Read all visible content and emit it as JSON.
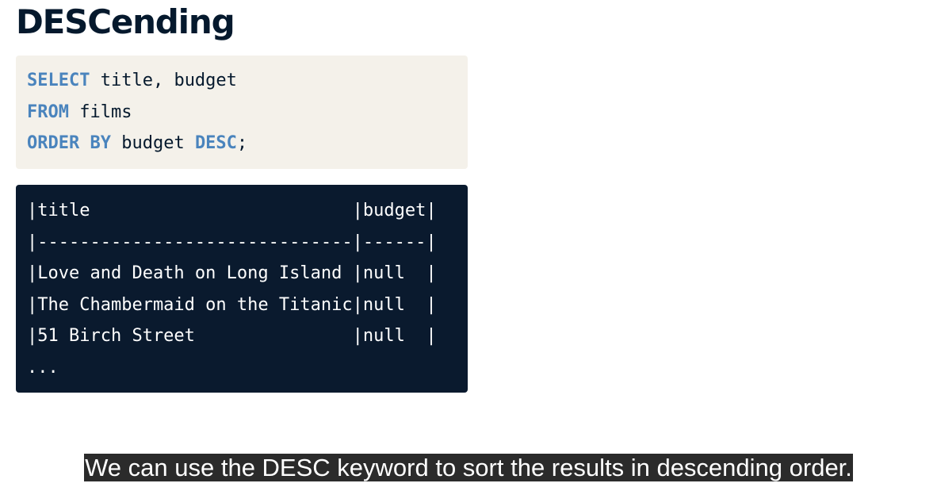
{
  "title": "DESCending",
  "query": {
    "line1": {
      "keyword": "SELECT",
      "rest": " title, budget"
    },
    "line2": {
      "keyword": "FROM",
      "rest": " films"
    },
    "line3": {
      "keyword1": "ORDER BY",
      "middle": " budget ",
      "keyword2": "DESC",
      "end": ";"
    }
  },
  "output": {
    "lines": [
      "|title                         |budget|",
      "|------------------------------|------|",
      "|Love and Death on Long Island |null  |",
      "|The Chambermaid on the Titanic|null  |",
      "|51 Birch Street               |null  |",
      "..."
    ]
  },
  "caption": "We can use the DESC keyword to sort the results in descending order.",
  "colors": {
    "keyword": "#4a84bd",
    "code_background": "#f4f1ea",
    "output_background": "#0a1a2e",
    "caption_background": "#2b2b2b"
  }
}
